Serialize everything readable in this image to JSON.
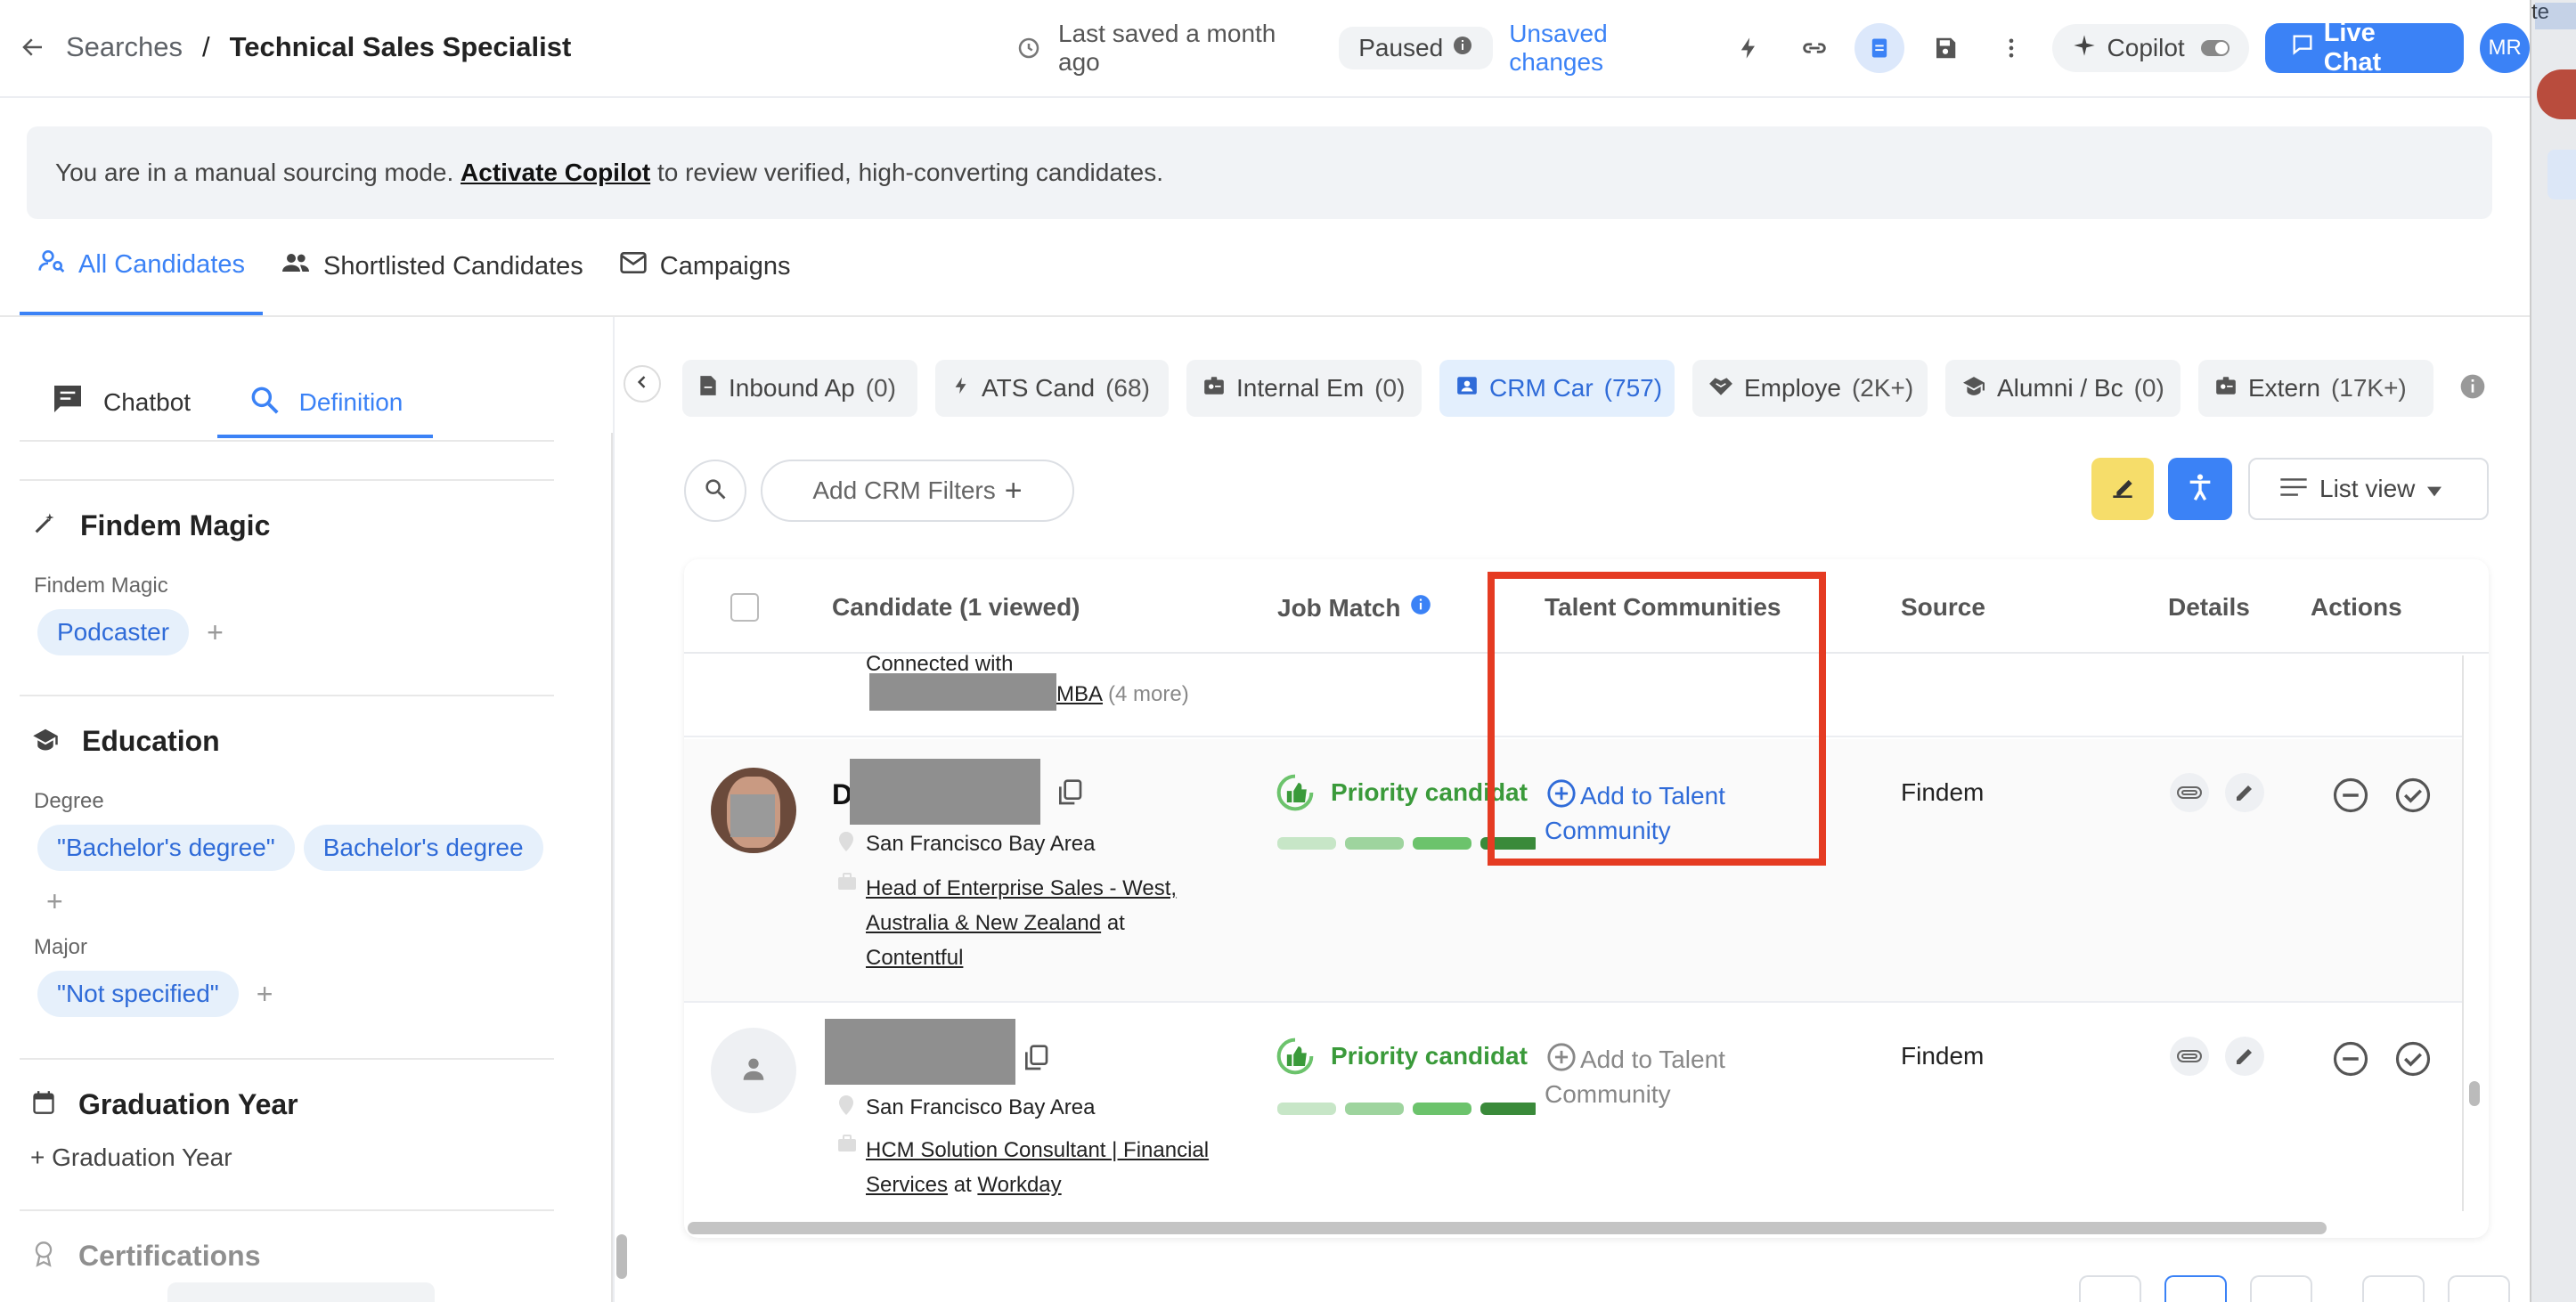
{
  "header": {
    "breadcrumb_root": "Searches",
    "breadcrumb_sep": "/",
    "title": "Technical Sales Specialist",
    "last_saved": "Last saved a month ago",
    "status": "Paused",
    "unsaved": "Unsaved changes",
    "copilot": "Copilot",
    "live_chat": "Live Chat",
    "avatar": "MR",
    "right_edge_text": "te"
  },
  "banner": {
    "prefix": "You are in a manual sourcing mode.",
    "link": "Activate Copilot",
    "suffix": "to review verified, high-converting candidates."
  },
  "tabs": [
    {
      "label": "All Candidates",
      "active": true
    },
    {
      "label": "Shortlisted Candidates"
    },
    {
      "label": "Campaigns"
    }
  ],
  "left_panel": {
    "tabs": [
      "Chatbot",
      "Definition"
    ],
    "findem_magic": {
      "title": "Findem Magic",
      "label": "Findem Magic",
      "chips": [
        "Podcaster"
      ]
    },
    "education": {
      "title": "Education",
      "degree_label": "Degree",
      "degree_chips": [
        "\"Bachelor's degree\"",
        "Bachelor's degree"
      ],
      "major_label": "Major",
      "major_chips": [
        "\"Not specified\""
      ]
    },
    "graduation": {
      "title": "Graduation Year",
      "add": "+ Graduation Year"
    },
    "certifications": {
      "title": "Certifications"
    }
  },
  "source_tabs": [
    {
      "label": "Inbound Ap",
      "count": "(0)"
    },
    {
      "label": "ATS Cand",
      "count": "(68)"
    },
    {
      "label": "Internal Em",
      "count": "(0)"
    },
    {
      "label": "CRM Car",
      "count": "(757)",
      "active": true
    },
    {
      "label": "Employe",
      "count": "(2K+)"
    },
    {
      "label": "Alumni / Bc",
      "count": "(0)"
    },
    {
      "label": "Extern",
      "count": "(17K+)"
    }
  ],
  "filters": {
    "add_crm": "Add CRM Filters",
    "view": "List view"
  },
  "table": {
    "headers": {
      "candidate": "Candidate (1 viewed)",
      "job_match": "Job Match",
      "talent": "Talent Communities",
      "source": "Source",
      "details": "Details",
      "actions": "Actions"
    },
    "partial_row": {
      "connected": "Connected with",
      "mba": "MBA",
      "more": "(4 more)"
    },
    "rows": [
      {
        "initial": "D",
        "location": "San Francisco Bay Area",
        "role": "Head of Enterprise Sales - West, Australia & New Zealand",
        "at": "at",
        "company": "Contentful",
        "match": "Priority candidat",
        "talent": "Add to Talent Community",
        "source": "Findem"
      },
      {
        "location": "San Francisco Bay Area",
        "role": "HCM Solution Consultant | Financial Services",
        "at": "at",
        "company": "Workday",
        "match": "Priority candidat",
        "talent": "Add to Talent Community",
        "source": "Findem"
      }
    ]
  },
  "colors": {
    "accent": "#3b82f6",
    "highlight": "#e53b22",
    "match_green": "#3a9a3a",
    "toolbar_yellow": "#f6dd6a"
  }
}
